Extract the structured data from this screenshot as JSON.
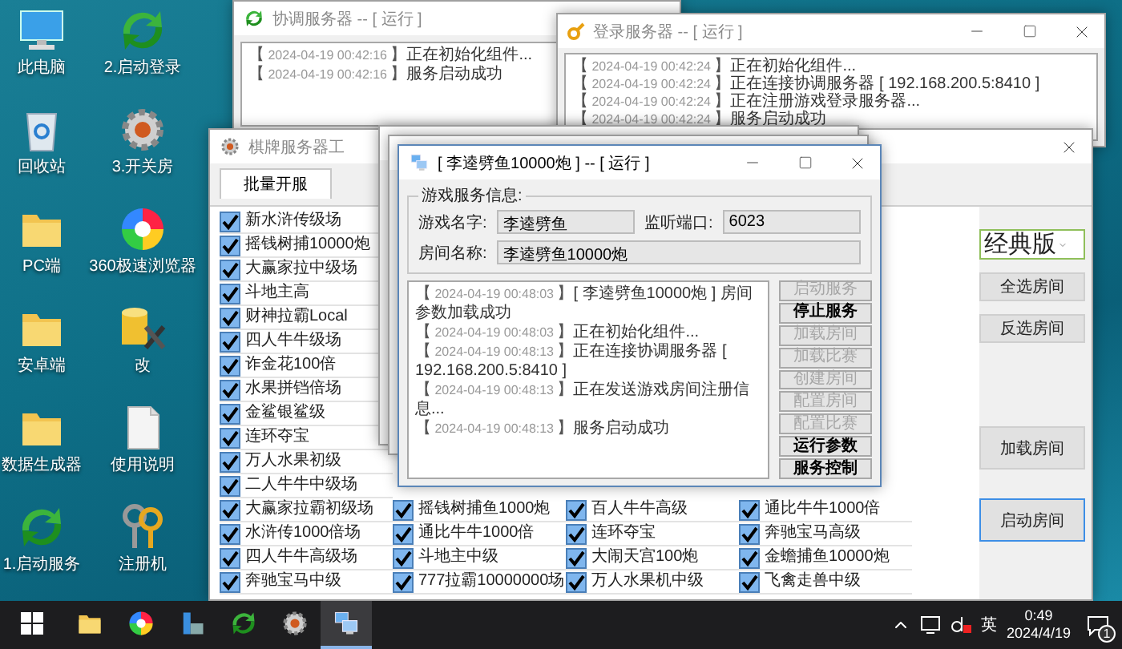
{
  "desktop_icons": [
    {
      "label": "此电脑",
      "kind": "computer"
    },
    {
      "label": "2.启动登录",
      "kind": "sync"
    },
    {
      "label": "回收站",
      "kind": "recycle"
    },
    {
      "label": "3.开关房",
      "kind": "gear"
    },
    {
      "label": "PC端",
      "kind": "folder"
    },
    {
      "label": "360极速浏览器",
      "kind": "browser"
    },
    {
      "label": "安卓端",
      "kind": "folder"
    },
    {
      "label": "改",
      "kind": "database"
    },
    {
      "label": "数据生成器",
      "kind": "folder"
    },
    {
      "label": "使用说明",
      "kind": "document"
    },
    {
      "label": "1.启动服务",
      "kind": "sync"
    },
    {
      "label": "注册机",
      "kind": "keys"
    }
  ],
  "coordinator_window": {
    "title": "协调服务器 -- [ 运行 ]",
    "log": [
      {
        "time": "【 2024-04-19 00:42:16 】",
        "message": "正在初始化组件..."
      },
      {
        "time": "【 2024-04-19 00:42:16 】",
        "message": "服务启动成功"
      }
    ]
  },
  "login_window": {
    "title": "登录服务器 -- [ 运行 ]",
    "log": [
      {
        "time": "【 2024-04-19 00:42:24 】",
        "message": "正在初始化组件..."
      },
      {
        "time": "【 2024-04-19 00:42:24 】",
        "message": "正在连接协调服务器 [ 192.168.200.5:8410 ]"
      },
      {
        "time": "【 2024-04-19 00:42:24 】",
        "message": "正在注册游戏登录服务器..."
      },
      {
        "time": "【 2024-04-19 00:42:24 】",
        "message": "服务启动成功"
      }
    ]
  },
  "room_manager_window": {
    "title": "棋牌服务器工",
    "tabs": [
      {
        "label": "批量开服",
        "selected": true
      }
    ],
    "room_columns": [
      [
        {
          "label": "新水浒传级场",
          "checked": true
        },
        {
          "label": "摇钱树捕10000炮",
          "checked": true
        },
        {
          "label": "大赢家拉中级场",
          "checked": true
        },
        {
          "label": "斗地主高",
          "checked": true
        },
        {
          "label": "财神拉霸Local",
          "checked": true
        },
        {
          "label": "四人牛牛级场",
          "checked": true
        },
        {
          "label": "诈金花100倍",
          "checked": true
        },
        {
          "label": "水果拼铛倍场",
          "checked": true
        },
        {
          "label": "金鲨银鲨级",
          "checked": true
        },
        {
          "label": "连环夺宝",
          "checked": true
        },
        {
          "label": "万人水果初级",
          "checked": true
        },
        {
          "label": "二人牛牛中级场",
          "checked": true
        },
        {
          "label": "大赢家拉霸初级场",
          "checked": true
        },
        {
          "label": "水浒传1000倍场",
          "checked": true
        },
        {
          "label": "四人牛牛高级场",
          "checked": true
        },
        {
          "label": "奔驰宝马中级",
          "checked": true
        }
      ],
      [
        {
          "label": "摇钱树捕鱼1000炮",
          "checked": true
        },
        {
          "label": "通比牛牛1000倍",
          "checked": true
        },
        {
          "label": "斗地主中级",
          "checked": true
        },
        {
          "label": "777拉霸10000000场",
          "checked": true
        }
      ],
      [
        {
          "label": "百人牛牛高级",
          "checked": true
        },
        {
          "label": "连环夺宝",
          "checked": true
        },
        {
          "label": "大闹天宫100炮",
          "checked": true
        },
        {
          "label": "万人水果机中级",
          "checked": true
        }
      ],
      [
        {
          "label": "通比牛牛1000倍",
          "checked": true
        },
        {
          "label": "奔驰宝马高级",
          "checked": true
        },
        {
          "label": "金蟾捕鱼10000炮",
          "checked": true
        },
        {
          "label": "飞禽走兽中级",
          "checked": true
        }
      ]
    ],
    "edition_select": {
      "value": "经典版"
    },
    "selection_buttons": [
      "全选房间",
      "反选房间"
    ],
    "action_buttons": [
      {
        "label": "加载房间",
        "focused": false
      },
      {
        "label": "启动房间",
        "focused": true
      }
    ]
  },
  "room_window": {
    "title": "[ 李逵劈鱼10000炮 ] -- [ 运行 ]",
    "info_heading": "游戏服务信息:",
    "game_name": {
      "label": "游戏名字:",
      "value": "李逵劈鱼"
    },
    "port": {
      "label": "监听端口:",
      "value": "6023"
    },
    "room_name": {
      "label": "房间名称:",
      "value": "李逵劈鱼10000炮"
    },
    "log": [
      {
        "time": "【 2024-04-19 00:48:03 】",
        "message": "[ 李逵劈鱼10000炮 ] 房间参数加载成功"
      },
      {
        "time": "【 2024-04-19 00:48:03 】",
        "message": "正在初始化组件..."
      },
      {
        "time": "【 2024-04-19 00:48:13 】",
        "message": "正在连接协调服务器 [ 192.168.200.5:8410 ]"
      },
      {
        "time": "【 2024-04-19 00:48:13 】",
        "message": "正在发送游戏房间注册信息..."
      },
      {
        "time": "【 2024-04-19 00:48:13 】",
        "message": "服务启动成功"
      }
    ],
    "buttons": [
      {
        "label": "启动服务",
        "disabled": true
      },
      {
        "label": "停止服务",
        "disabled": false
      },
      {
        "label": "加载房间",
        "disabled": true
      },
      {
        "label": "加载比赛",
        "disabled": true
      },
      {
        "label": "创建房间",
        "disabled": true
      },
      {
        "label": "配置房间",
        "disabled": true
      },
      {
        "label": "配置比赛",
        "disabled": true
      },
      {
        "label": "运行参数",
        "disabled": false
      },
      {
        "label": "服务控制",
        "disabled": false
      }
    ]
  },
  "taskbar": {
    "apps": [
      {
        "kind": "folder",
        "active": false
      },
      {
        "kind": "browser",
        "active": false
      },
      {
        "kind": "app",
        "active": false
      },
      {
        "kind": "sync",
        "active": false
      },
      {
        "kind": "gear",
        "active": false
      },
      {
        "kind": "monitor",
        "active": true
      }
    ],
    "language": "英",
    "time": "0:49",
    "date": "2024/4/19",
    "notification_count": "1"
  }
}
